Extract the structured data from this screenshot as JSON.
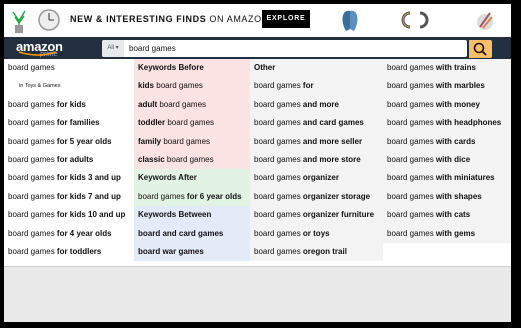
{
  "banner": {
    "text_bold": "NEW & INTERESTING FINDS",
    "text_rest": " ON AMAZON",
    "explore": "EXPLORE"
  },
  "header": {
    "logo": "amazon",
    "logo_sub": "prime",
    "category": "All",
    "query": "board games"
  },
  "columns": {
    "left": [
      {
        "pre": "board games",
        "bold": ""
      },
      {
        "small": "in Toys & Games"
      },
      {
        "pre": "board games ",
        "bold": "for kids"
      },
      {
        "pre": "board games ",
        "bold": "for families"
      },
      {
        "pre": "board games ",
        "bold": "for 5 year olds"
      },
      {
        "pre": "board games ",
        "bold": "for adults"
      },
      {
        "pre": "board games ",
        "bold": "for kids 3 and up"
      },
      {
        "pre": "board games ",
        "bold": "for kids 7 and up"
      },
      {
        "pre": "board games ",
        "bold": "for kids 10 and up"
      },
      {
        "pre": "board games ",
        "bold": "for 4 year olds"
      },
      {
        "pre": "board games ",
        "bold": "for toddlers"
      }
    ],
    "keywords": [
      {
        "header": "Keywords Before",
        "tone": "pink"
      },
      {
        "boldpre": "kids",
        "rest": " board games",
        "tone": "pink"
      },
      {
        "boldpre": "adult",
        "rest": " board games",
        "tone": "pink"
      },
      {
        "boldpre": "toddler",
        "rest": " board games",
        "tone": "pink"
      },
      {
        "boldpre": "family",
        "rest": " board games",
        "tone": "pink"
      },
      {
        "boldpre": "classic",
        "rest": " board games",
        "tone": "pink"
      },
      {
        "header": "Keywords After",
        "tone": "green"
      },
      {
        "pre": "board games ",
        "bold": "for 6 year olds",
        "tone": "green"
      },
      {
        "header": "Keywords Between",
        "tone": "blue"
      },
      {
        "boldpre": "board",
        "rest": " and card games",
        "tone": "blue",
        "mixed": true
      },
      {
        "boldpre": "board",
        "rest": " war games",
        "tone": "blue",
        "mixed2": true
      }
    ],
    "other": [
      {
        "header": "Other"
      },
      {
        "pre": "board games ",
        "bold": "for"
      },
      {
        "pre": "board games ",
        "bold": "and more"
      },
      {
        "pre": "board games ",
        "bold": "and card games"
      },
      {
        "pre": "board games ",
        "bold": "and more seller"
      },
      {
        "pre": "board games ",
        "bold": "and more store"
      },
      {
        "pre": "board games ",
        "bold": "organizer"
      },
      {
        "pre": "board games ",
        "bold": "organizer storage"
      },
      {
        "pre": "board games ",
        "bold": "organizer furniture"
      },
      {
        "pre": "board games ",
        "bold": "or toys"
      },
      {
        "pre": "board games ",
        "bold": "oregon trail"
      }
    ],
    "right": [
      {
        "pre": "board games ",
        "bold": "with trains"
      },
      {
        "pre": "board games ",
        "bold": "with marbles"
      },
      {
        "pre": "board games ",
        "bold": "with money"
      },
      {
        "pre": "board games ",
        "bold": "with headphones"
      },
      {
        "pre": "board games ",
        "bold": "with cards"
      },
      {
        "pre": "board games ",
        "bold": "with dice"
      },
      {
        "pre": "board games ",
        "bold": "with miniatures"
      },
      {
        "pre": "board games ",
        "bold": "with shapes"
      },
      {
        "pre": "board games ",
        "bold": "with cats"
      },
      {
        "pre": "board games ",
        "bold": "with gems"
      }
    ]
  }
}
